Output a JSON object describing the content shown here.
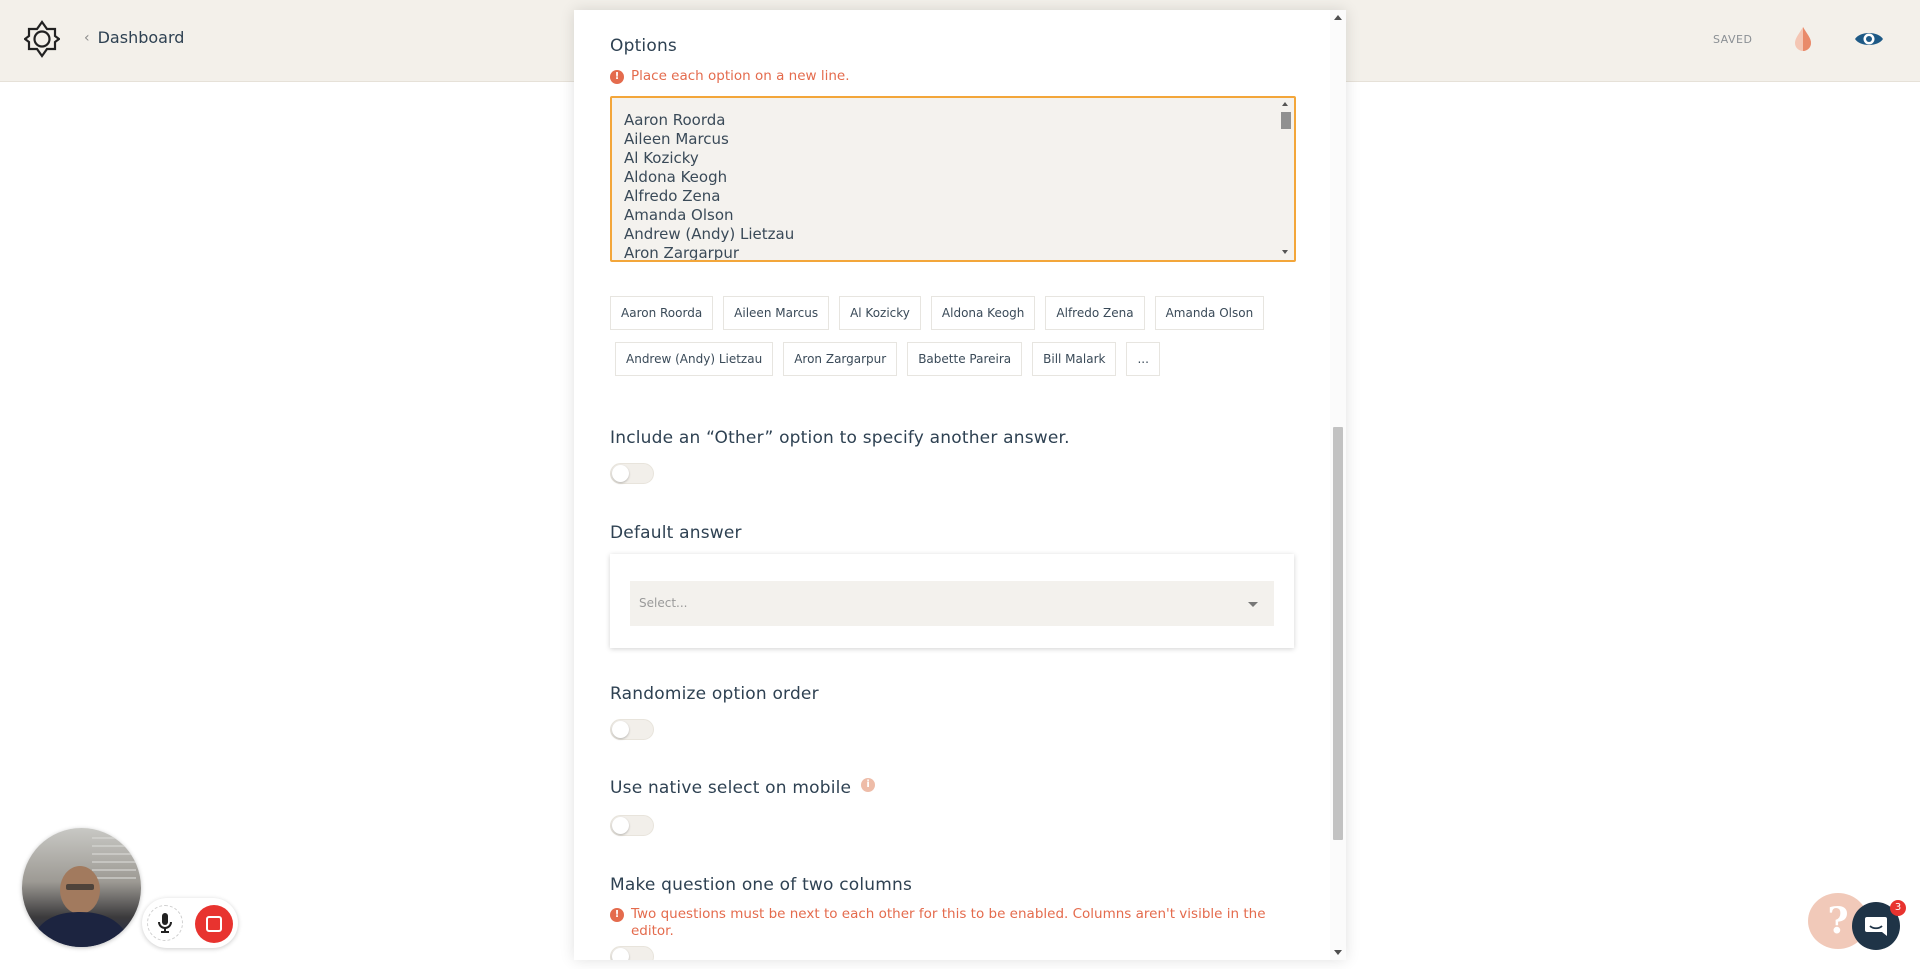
{
  "header": {
    "back_label": "Dashboard",
    "status": "SAVED"
  },
  "options_section": {
    "label": "Options",
    "hint": "Place each option on a new line.",
    "textarea_lines": [
      "Aaron Roorda",
      "Aileen Marcus",
      "Al Kozicky",
      "Aldona Keogh",
      "Alfredo Zena",
      "Amanda Olson",
      "Andrew (Andy) Lietzau",
      "Aron Zargarpur"
    ],
    "chips_row1": [
      "Aaron Roorda",
      "Aileen Marcus",
      "Al Kozicky",
      "Aldona Keogh",
      "Alfredo Zena",
      "Amanda Olson"
    ],
    "chips_row2": [
      "Andrew (Andy) Lietzau",
      "Aron Zargarpur",
      "Babette Pareira",
      "Bill Malark",
      "..."
    ]
  },
  "other_option": {
    "label": "Include an “Other” option to specify another answer."
  },
  "default_answer": {
    "label": "Default answer",
    "placeholder": "Select..."
  },
  "randomize": {
    "label": "Randomize option order"
  },
  "native_select": {
    "label": "Use native select on mobile"
  },
  "columns": {
    "label": "Make question one of two columns",
    "hint": "Two questions must be next to each other for this to be enabled. Columns aren't visible in the editor."
  },
  "chat": {
    "badge_count": "3"
  },
  "colors": {
    "accent_orange": "#f3a63a",
    "hint_red": "#e46b4d",
    "topbar_bg": "#f3f0ea",
    "eye_blue": "#1e5a86",
    "record_red": "#e8332f"
  }
}
